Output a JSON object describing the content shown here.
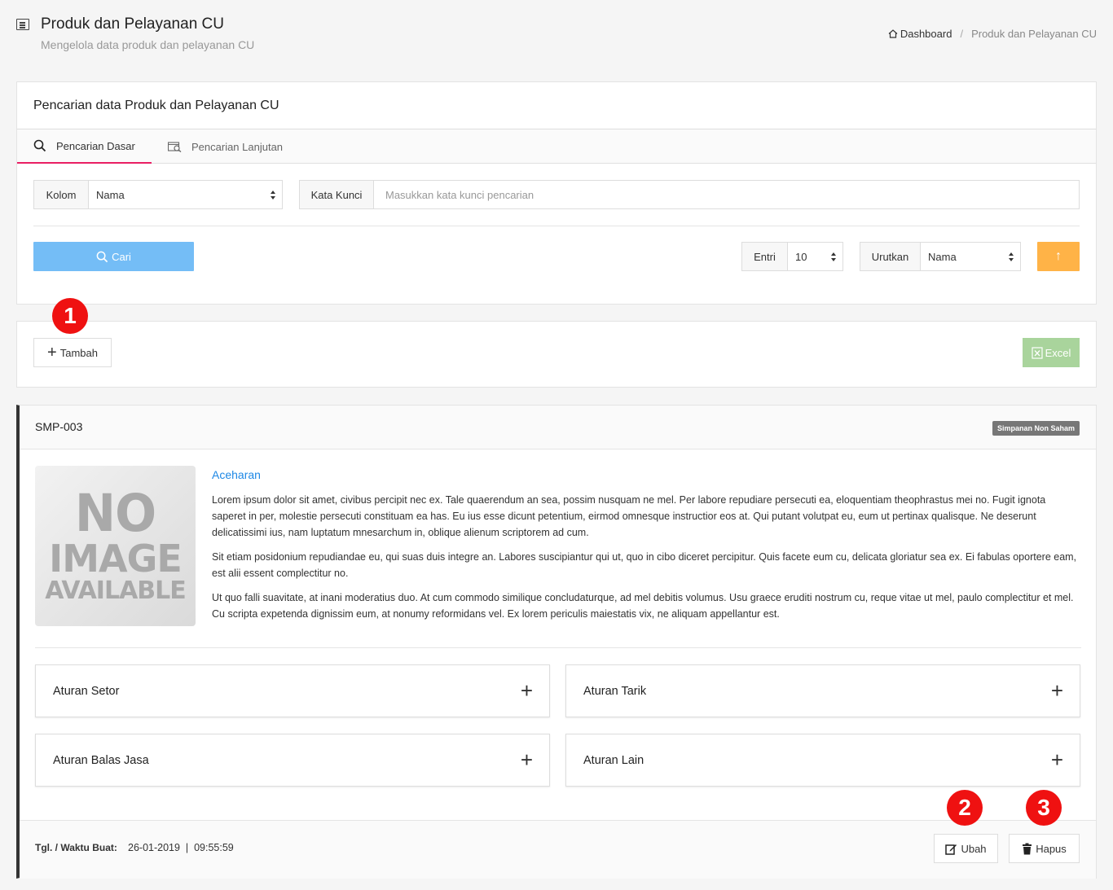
{
  "header": {
    "title": "Produk dan Pelayanan CU",
    "subtitle": "Mengelola data produk dan pelayanan CU",
    "breadcrumb": {
      "home": "Dashboard",
      "current": "Produk dan Pelayanan CU"
    }
  },
  "search": {
    "title": "Pencarian data Produk dan Pelayanan CU",
    "tabs": [
      "Pencarian Dasar",
      "Pencarian Lanjutan"
    ],
    "kolom_label": "Kolom",
    "kolom_value": "Nama",
    "kata_kunci_label": "Kata Kunci",
    "kata_kunci_placeholder": "Masukkan kata kunci pencarian",
    "cari_label": "Cari",
    "entri_label": "Entri",
    "entri_value": "10",
    "urutkan_label": "Urutkan",
    "urutkan_value": "Nama",
    "sort_icon": "↑"
  },
  "actions": {
    "tambah_label": "Tambah",
    "excel_label": "Excel"
  },
  "annotations": [
    "1",
    "2",
    "3"
  ],
  "product": {
    "code": "SMP-003",
    "category_badge": "Simpanan Non Saham",
    "image_placeholder": [
      "NO",
      "IMAGE",
      "AVAILABLE"
    ],
    "name": "Aceharan",
    "description": [
      "Lorem ipsum dolor sit amet, civibus percipit nec ex. Tale quaerendum an sea, possim nusquam ne mel. Per labore repudiare persecuti ea, eloquentiam theophrastus mei no. Fugit ignota saperet in per, molestie persecuti constituam ea has. Eu ius esse dicunt petentium, eirmod omnesque instructior eos at. Qui putant volutpat eu, eum ut pertinax qualisque. Ne deserunt delicatissimi ius, nam luptatum mnesarchum in, oblique alienum scriptorem ad cum.",
      "Sit etiam posidonium repudiandae eu, qui suas duis integre an. Labores suscipiantur qui ut, quo in cibo diceret percipitur. Quis facete eum cu, delicata gloriatur sea ex. Ei fabulas oportere eam, est alii essent complectitur no.",
      "Ut quo falli suavitate, at inani moderatius duo. At cum commodo similique concludaturque, ad mel debitis volumus. Usu graece eruditi nostrum cu, reque vitae ut mel, paulo complectitur et mel. Cu scripta expetenda dignissim eum, at nonumy reformidans vel. Ex lorem periculis maiestatis vix, ne aliquam appellantur est."
    ],
    "rules": [
      "Aturan Setor",
      "Aturan Tarik",
      "Aturan Balas Jasa",
      "Aturan Lain"
    ],
    "created_label": "Tgl. / Waktu Buat:",
    "created_value": "26-01-2019  |  09:55:59",
    "ubah_label": "Ubah",
    "hapus_label": "Hapus"
  },
  "colors": {
    "primary_button": "#74bdf6",
    "sort_button": "#ffb347",
    "excel_button": "#a9d49c",
    "tab_active": "#e91e63",
    "link": "#1e88e5",
    "annotation": "#ef1111"
  }
}
